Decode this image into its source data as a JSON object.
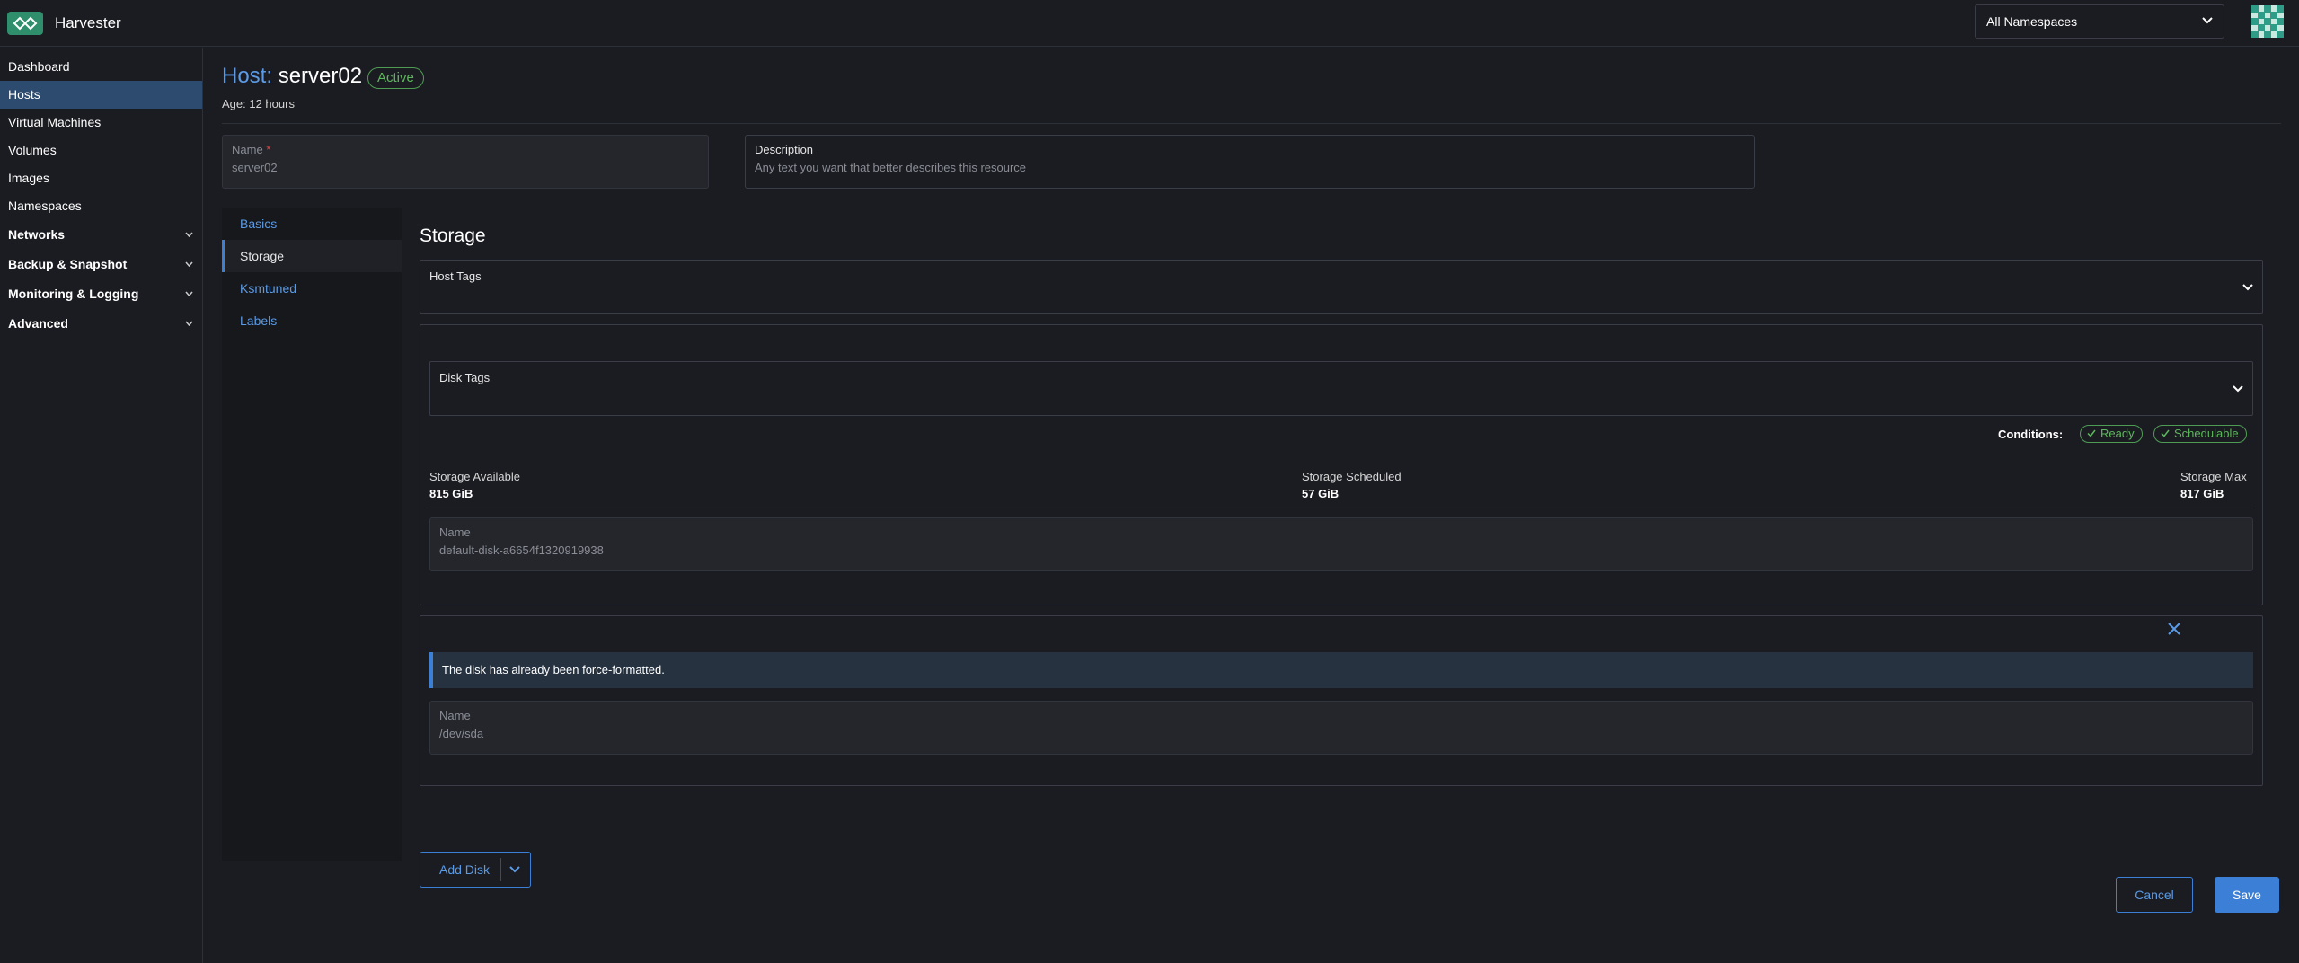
{
  "header": {
    "app_title": "Harvester",
    "namespace_select": "All Namespaces"
  },
  "sidebar": {
    "items": [
      {
        "label": "Dashboard"
      },
      {
        "label": "Hosts"
      },
      {
        "label": "Virtual Machines"
      },
      {
        "label": "Volumes"
      },
      {
        "label": "Images"
      },
      {
        "label": "Namespaces"
      },
      {
        "label": "Networks"
      },
      {
        "label": "Backup & Snapshot"
      },
      {
        "label": "Monitoring & Logging"
      },
      {
        "label": "Advanced"
      }
    ],
    "active": "Hosts"
  },
  "page": {
    "title_prefix": "Host:",
    "title_name": "server02",
    "state": "Active",
    "age": "Age: 12 hours"
  },
  "form": {
    "name_label": "Name",
    "name_required": "*",
    "name_value": "server02",
    "description_label": "Description",
    "description_placeholder": "Any text you want that better describes this resource"
  },
  "tabs": [
    {
      "label": "Basics"
    },
    {
      "label": "Storage"
    },
    {
      "label": "Ksmtuned"
    },
    {
      "label": "Labels"
    }
  ],
  "active_tab": "Storage",
  "storage": {
    "title": "Storage",
    "host_tags_label": "Host Tags",
    "disk1": {
      "disk_tags_label": "Disk Tags",
      "conditions_label": "Conditions:",
      "conditions": [
        "Ready",
        "Schedulable"
      ],
      "available_label": "Storage Available",
      "available_value": "815 GiB",
      "scheduled_label": "Storage Scheduled",
      "scheduled_value": "57 GiB",
      "max_label": "Storage Max",
      "max_value": "817 GiB",
      "name_label": "Name",
      "name_value": "default-disk-a6654f1320919938"
    },
    "disk2": {
      "alert": "The disk has already been force-formatted.",
      "name_label": "Name",
      "name_value": "/dev/sda"
    },
    "add_disk_label": "Add Disk"
  },
  "footer": {
    "cancel_label": "Cancel",
    "save_label": "Save"
  },
  "colors": {
    "background": "#1b1c21",
    "accent": "#3b7fd6",
    "success": "#5cb85c",
    "active_nav": "#2d4b6e"
  }
}
